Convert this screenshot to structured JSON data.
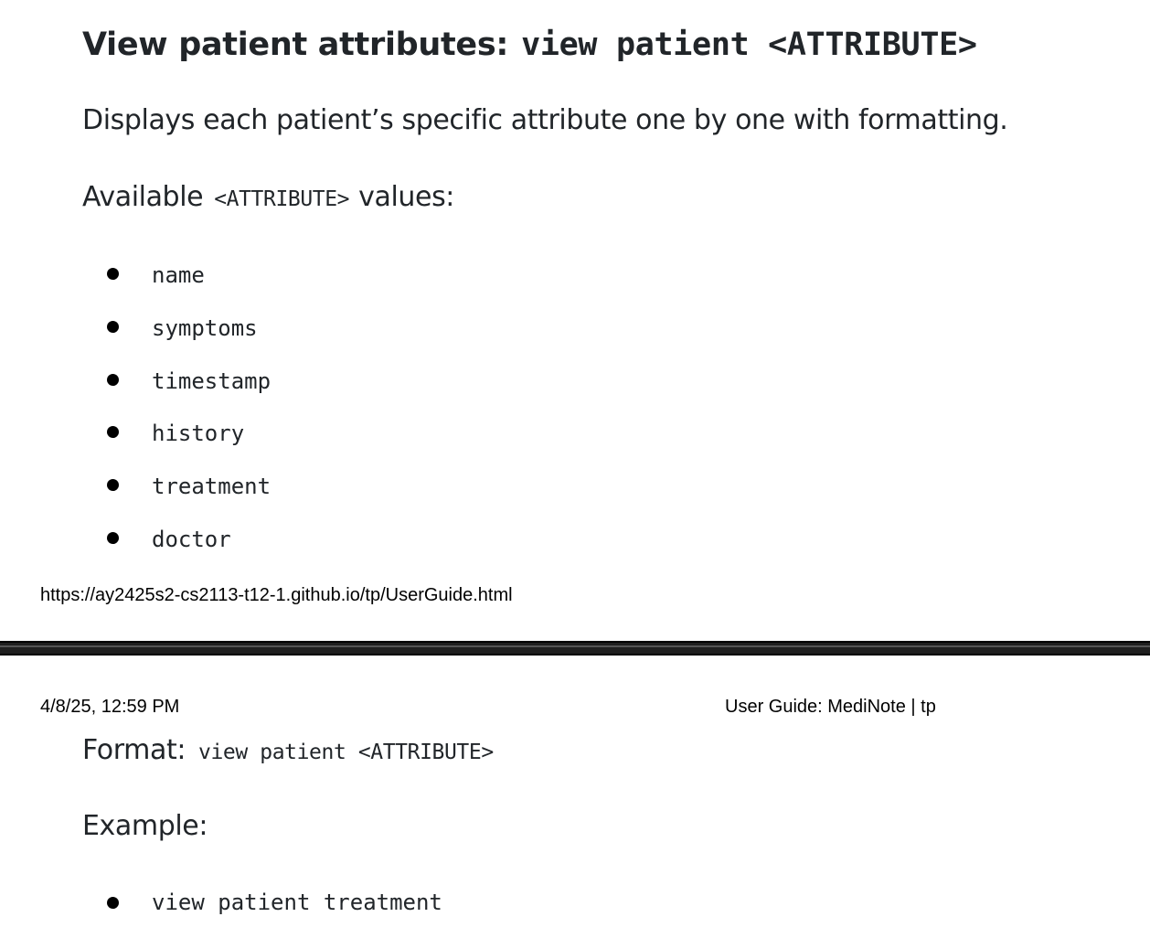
{
  "section": {
    "heading_text": "View patient attributes:",
    "heading_code": "view patient <ATTRIBUTE>",
    "description": "Displays each patient’s specific attribute one by one with formatting.",
    "available_prefix": "Available",
    "available_code": "<ATTRIBUTE>",
    "available_suffix": "values:",
    "attributes": [
      "name",
      "symptoms",
      "timestamp",
      "history",
      "treatment",
      "doctor"
    ]
  },
  "print_footer": {
    "url": "https://ay2425s2-cs2113-t12-1.github.io/tp/UserGuide.html"
  },
  "print_header": {
    "datetime": "4/8/25, 12:59 PM",
    "title": "User Guide: MediNote | tp"
  },
  "format": {
    "label": "Format:",
    "code": "view patient <ATTRIBUTE>"
  },
  "example": {
    "label": "Example:",
    "items": [
      "view patient treatment"
    ]
  }
}
